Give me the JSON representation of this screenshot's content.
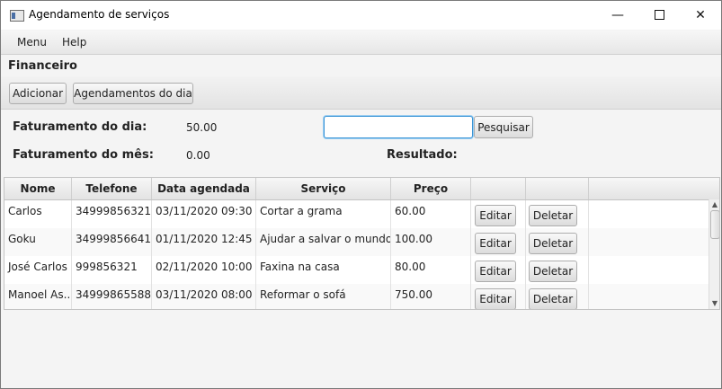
{
  "window": {
    "title": "Agendamento de serviços",
    "controls": {
      "minimize": "—",
      "close": "✕"
    }
  },
  "menu": {
    "items": [
      "Menu",
      "Help"
    ]
  },
  "section_title": "Financeiro",
  "toolbar": {
    "add_label": "Adicionar",
    "day_schedules_label": "Agendamentos do dia"
  },
  "summary": {
    "day_label": "Faturamento do dia:",
    "day_value": "50.00",
    "month_label": "Faturamento do mês:",
    "month_value": "0.00",
    "result_label": "Resultado:"
  },
  "search": {
    "value": "",
    "placeholder": "",
    "button_label": "Pesquisar"
  },
  "table": {
    "columns": [
      "Nome",
      "Telefone",
      "Data agendada",
      "Serviço",
      "Preço",
      "",
      ""
    ],
    "edit_label": "Editar",
    "delete_label": "Deletar",
    "rows": [
      {
        "nome": "Carlos",
        "telefone": "34999856321",
        "data": "03/11/2020 09:30",
        "servico": "Cortar a grama",
        "preco": "60.00"
      },
      {
        "nome": "Goku",
        "telefone": "34999856641",
        "data": "01/11/2020 12:45",
        "servico": "Ajudar a salvar o mundo",
        "preco": "100.00"
      },
      {
        "nome": "José Carlos",
        "telefone": "999856321",
        "data": "02/11/2020 10:00",
        "servico": "Faxina na casa",
        "preco": "80.00"
      },
      {
        "nome": "Manoel As...",
        "telefone": "34999865588",
        "data": "03/11/2020 08:00",
        "servico": "Reformar o sofá",
        "preco": "750.00"
      }
    ]
  },
  "colors": {
    "focus_border": "#3a94d6",
    "window_bg": "#f4f4f4"
  },
  "icons": {
    "app": "app-window-icon",
    "minimize": "minimize-icon",
    "maximize": "maximize-icon",
    "close": "close-icon"
  }
}
